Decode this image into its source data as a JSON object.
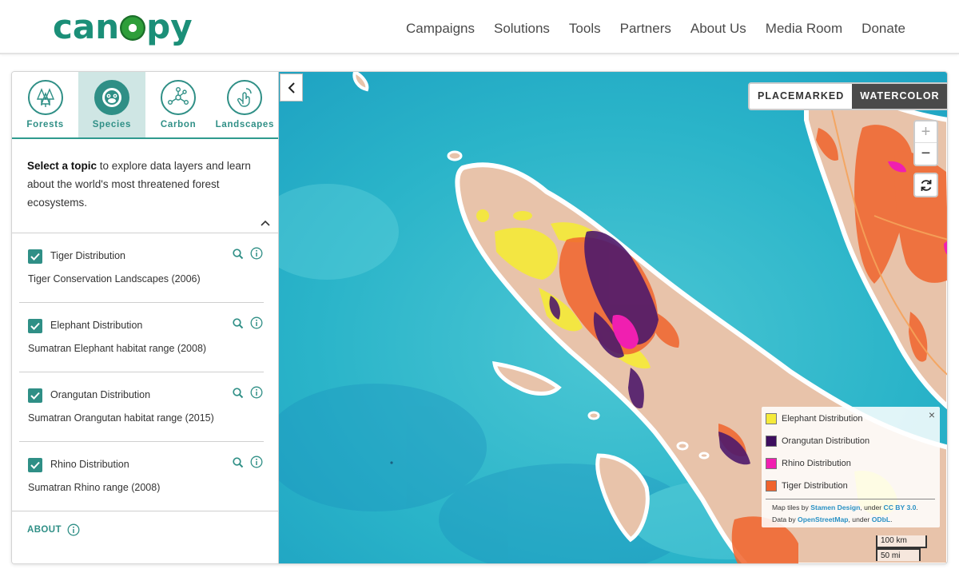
{
  "header": {
    "logo_text": "canopy",
    "nav": [
      "Campaigns",
      "Solutions",
      "Tools",
      "Partners",
      "About Us",
      "Media Room",
      "Donate"
    ]
  },
  "sidebar": {
    "tabs": [
      {
        "label": "Forests",
        "icon": "trees-icon",
        "active": false
      },
      {
        "label": "Species",
        "icon": "orangutan-icon",
        "active": true
      },
      {
        "label": "Carbon",
        "icon": "molecule-icon",
        "active": false
      },
      {
        "label": "Landscapes",
        "icon": "hand-pointer-icon",
        "active": false
      }
    ],
    "intro_bold": "Select a topic",
    "intro_rest": " to explore data layers and learn about the world's most threatened forest ecosystems.",
    "layers": [
      {
        "title": "Tiger Distribution",
        "subtitle": "Tiger Conservation Landscapes (2006)",
        "checked": true
      },
      {
        "title": "Elephant Distribution",
        "subtitle": "Sumatran Elephant habitat range (2008)",
        "checked": true
      },
      {
        "title": "Orangutan Distribution",
        "subtitle": "Sumatran Orangutan habitat range (2015)",
        "checked": true
      },
      {
        "title": "Rhino Distribution",
        "subtitle": "Sumatran Rhino range (2008)",
        "checked": true
      }
    ],
    "about_label": "ABOUT"
  },
  "map": {
    "basemap": {
      "placemarked": "PLACEMARKED",
      "watercolor": "WATERCOLOR",
      "selected": "WATERCOLOR"
    },
    "zoom_in": "+",
    "zoom_out": "−",
    "legend": {
      "items": [
        {
          "label": "Elephant Distribution",
          "color": "#f5ea3a"
        },
        {
          "label": "Orangutan Distribution",
          "color": "#3d0e5e"
        },
        {
          "label": "Rhino Distribution",
          "color": "#f01fb0"
        },
        {
          "label": "Tiger Distribution",
          "color": "#f0642d"
        }
      ],
      "close": "×",
      "attr_1": "Map tiles by ",
      "attr_link_1": "Stamen Design",
      "attr_2": ", under ",
      "attr_link_2": "CC BY 3.0",
      "attr_3": ". Data by ",
      "attr_link_3": "OpenStreetMap",
      "attr_4": ", under ",
      "attr_link_4": "ODbL",
      "attr_5": "."
    },
    "scale": {
      "km": "100 km",
      "mi": "50 mi"
    }
  },
  "colors": {
    "accent": "#2f8f86",
    "water": "#2fb7c8",
    "land": "#e8c1a8"
  }
}
